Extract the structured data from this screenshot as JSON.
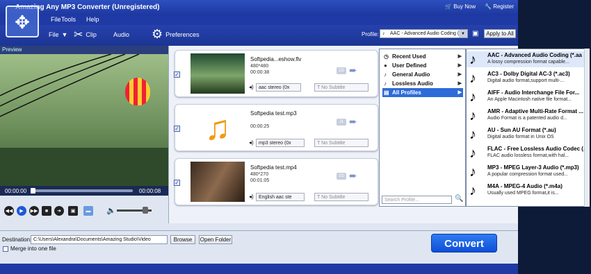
{
  "window": {
    "title": "Amazing Any MP3 Converter (Unregistered)"
  },
  "titlebar": {
    "buy_now": "Buy Now",
    "register": "Register"
  },
  "menu": {
    "items": [
      "File",
      "Tools",
      "Help"
    ]
  },
  "toolbar": {
    "add_file": "File",
    "clip": "Clip",
    "audio": "Audio",
    "preferences": "Preferences",
    "profile_label": "Profile:",
    "profile_value": "AAC - Advanced Audio Coding (*.aa",
    "apply_all": "Apply to All"
  },
  "preview": {
    "label": "Preview",
    "time_start": "00:00:00",
    "time_end": "00:00:08"
  },
  "files": [
    {
      "name": "Softpedia...eshow.flv",
      "res": "480*480",
      "dur": "00:00:38",
      "audio": "aac stereo (0x",
      "subtitle": "No Subtitle",
      "badge": "2D"
    },
    {
      "name": "Softpedia test.mp3",
      "res": "",
      "dur": "00:00:25",
      "audio": "mp3 stereo (0x",
      "subtitle": "No Subtitle",
      "badge": "J1"
    },
    {
      "name": "Softpedia test.mp4",
      "res": "480*270",
      "dur": "00:01:05",
      "audio": "English aac ste",
      "subtitle": "No Subtitle",
      "badge": "2D"
    }
  ],
  "categories": [
    "Recent Used",
    "User Defined",
    "General Audio",
    "Lossless Audio",
    "All Profiles"
  ],
  "search": {
    "placeholder": "Search Profile..."
  },
  "formats": [
    {
      "title": "AAC - Advanced Audio Coding (*.aa",
      "desc": "A lossy compression format capable..."
    },
    {
      "title": "AC3 - Dolby Digital AC-3 (*.ac3)",
      "desc": "Digital audio format,support multi-..."
    },
    {
      "title": "AIFF - Audio Interchange File For...",
      "desc": "An Apple Macintosh native file format..."
    },
    {
      "title": "AMR - Adaptive Multi-Rate Format ...",
      "desc": "Audio Format is a patented audio d..."
    },
    {
      "title": "AU - Sun AU Format (*.au)",
      "desc": "Digital audio format in Unix OS"
    },
    {
      "title": "FLAC - Free Lossless Audio Codec (...",
      "desc": "FLAC audio lossless format,with hal..."
    },
    {
      "title": "MP3 - MPEG Layer-3 Audio (*.mp3)",
      "desc": "A popular compression format used..."
    },
    {
      "title": "M4A - MPEG-4 Audio (*.m4a)",
      "desc": "Usually used MPEG format,it is..."
    }
  ],
  "bottom": {
    "destination_label": "Destination:",
    "destination_value": "C:\\Users\\Alexandra\\Documents\\Amazing Studio\\Video",
    "browse": "Browse",
    "open_folder": "Open Folder",
    "merge_label": "Merge into one file",
    "convert": "Convert"
  },
  "colors": {
    "title_bar": "#1d38a0",
    "convert_button": "#0e4fd8"
  }
}
